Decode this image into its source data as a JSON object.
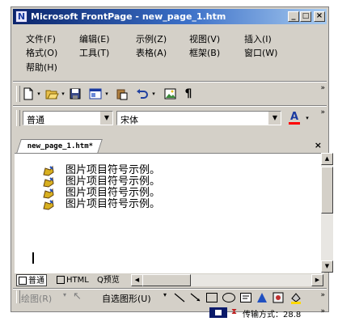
{
  "window": {
    "title": "Microsoft FrontPage - new_page_1.htm",
    "icon_letter": "N",
    "controls": [
      "_",
      "□",
      "×"
    ]
  },
  "menus": [
    {
      "label": "文件(F)"
    },
    {
      "label": "编辑(E)"
    },
    {
      "label": "示例(Z)"
    },
    {
      "label": "视图(V)"
    },
    {
      "label": "插入(I)"
    },
    {
      "label": "格式(O)"
    },
    {
      "label": "工具(T)"
    },
    {
      "label": "表格(A)"
    },
    {
      "label": "框架(B)"
    },
    {
      "label": "窗口(W)"
    },
    {
      "label": "帮助(H)"
    }
  ],
  "toolbar": {
    "icons": [
      "new-page-icon",
      "open-folder-icon",
      "save-icon",
      "web-component-icon",
      "paste-icon",
      "undo-icon",
      "insert-picture-icon",
      "paragraph-mark-icon"
    ],
    "more": "»"
  },
  "format_bar": {
    "style_value": "普通",
    "font_value": "宋体",
    "font_color_letter": "A",
    "font_color": "#ff0000",
    "more": "»"
  },
  "document": {
    "tab_label": "new_page_1.htm*",
    "close": "×",
    "list_items": [
      "图片项目符号示例。",
      "图片项目符号示例。",
      "图片项目符号示例。",
      "图片项目符号示例。"
    ]
  },
  "view_tabs": [
    {
      "label": "普通",
      "active": true
    },
    {
      "label": "HTML",
      "active": false
    },
    {
      "label": "预览",
      "active": false
    }
  ],
  "drawing": {
    "draw_label": "绘图(R)",
    "autoshapes_label": "自选图形(U)",
    "more": "»"
  },
  "status": {
    "transfer_text": "传输方式：28.8",
    "more": "»"
  }
}
